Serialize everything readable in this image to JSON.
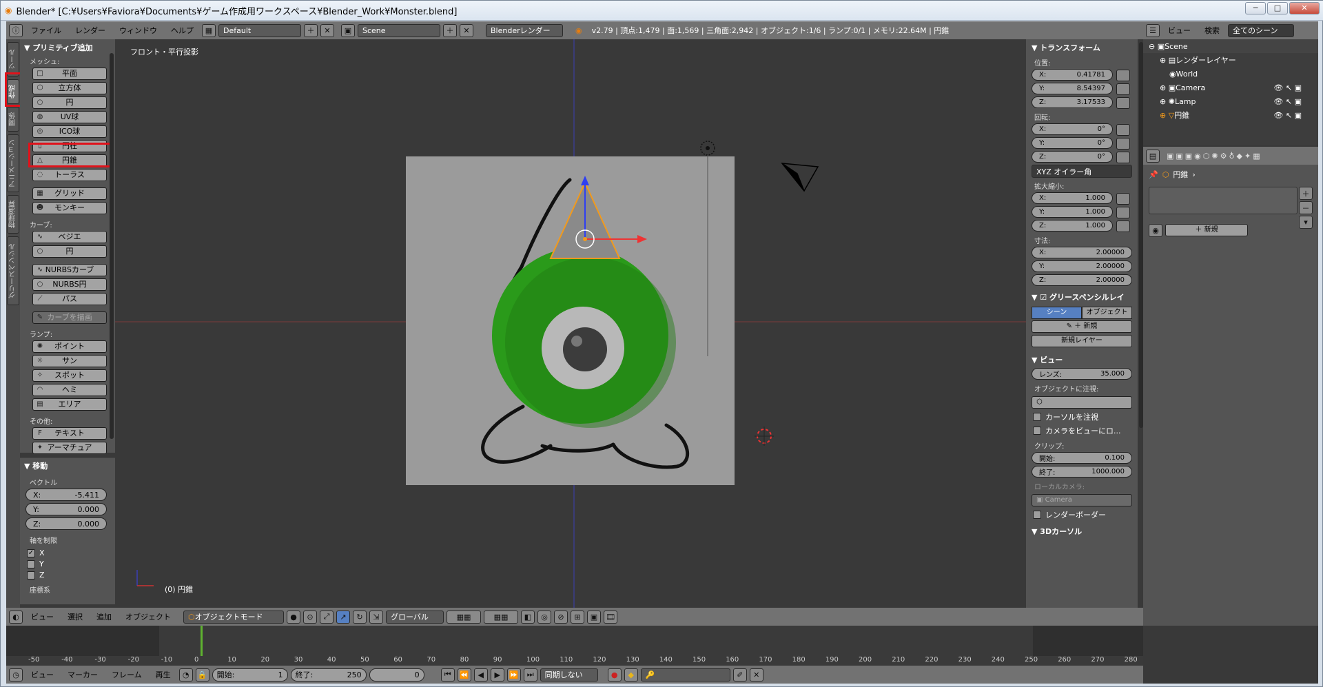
{
  "window": {
    "title": "Blender* [C:¥Users¥Faviora¥Documents¥ゲーム作成用ワークスペース¥Blender_Work¥Monster.blend]"
  },
  "info_header": {
    "menus": [
      "ファイル",
      "レンダー",
      "ウィンドウ",
      "ヘルプ"
    ],
    "layout": "Default",
    "scene": "Scene",
    "engine": "Blenderレンダー",
    "stats": "v2.79 | 頂点:1,479 | 面:1,569 | 三角面:2,942 | オブジェクト:1/6 | ランプ:0/1 | メモリ:22.64M | 円錐"
  },
  "tabs": [
    "ツール",
    "作成",
    "関係",
    "アニメーション",
    "物理演算",
    "グリースペンシル"
  ],
  "shelf": {
    "panel_title": "プリミティブ追加",
    "mesh_label": "メッシュ:",
    "mesh": [
      "平面",
      "立方体",
      "円",
      "UV球",
      "ICO球",
      "円柱",
      "円錐",
      "トーラス"
    ],
    "mesh2": [
      "グリッド",
      "モンキー"
    ],
    "curve_label": "カーブ:",
    "curve": [
      "ベジエ",
      "円"
    ],
    "nurbs": [
      "NURBSカーブ",
      "NURBS円",
      "パス"
    ],
    "draw_curve": "カーブを描画",
    "lamp_label": "ランプ:",
    "lamp": [
      "ポイント",
      "サン",
      "スポット",
      "ヘミ",
      "エリア"
    ],
    "other_label": "その他:",
    "other": [
      "テキスト",
      "アーマチュア"
    ]
  },
  "redo": {
    "title": "移動",
    "vector_label": "ベクトル",
    "x": "X:",
    "xv": "-5.411",
    "y": "Y:",
    "yv": "0.000",
    "z": "Z:",
    "zv": "0.000",
    "constraint_label": "軸を制限",
    "cx": "X",
    "cy": "Y",
    "cz": "Z",
    "coord": "座標系"
  },
  "viewport": {
    "view_label": "フロント・平行投影",
    "object_label": "(0) 円錐"
  },
  "npanel": {
    "transform": "トランスフォーム",
    "location": "位置:",
    "lx": "0.41781",
    "ly": "8.54397",
    "lz": "3.17533",
    "rotation": "回転:",
    "rx": "0°",
    "ry": "0°",
    "rz": "0°",
    "rotmode": "XYZ オイラー角",
    "scale": "拡大縮小:",
    "sx": "1.000",
    "sy": "1.000",
    "sz": "1.000",
    "dims": "寸法:",
    "dx": "2.00000",
    "dy": "2.00000",
    "dz": "2.00000",
    "gp": "グリースペンシルレイ",
    "scene_btn": "シーン",
    "object_btn": "オブジェクト",
    "new": "新規",
    "new_layer": "新規レイヤー",
    "view": "ビュー",
    "lens": "レンズ:",
    "lensv": "35.000",
    "lock_obj": "オブジェクトに注視:",
    "lock_cursor": "カーソルを注視",
    "cam_lock": "カメラをビューにロ...",
    "clip": "クリップ:",
    "clip_start": "開始:",
    "clip_start_v": "0.100",
    "clip_end": "終了:",
    "clip_end_v": "1000.000",
    "local_cam": "ローカルカメラ:",
    "camera": "Camera",
    "render_border": "レンダーボーダー",
    "cursor3d": "3Dカーソル"
  },
  "outliner": {
    "view": "ビュー",
    "search": "検索",
    "filter": "全てのシーン",
    "items": [
      "Scene",
      "レンダーレイヤー",
      "World",
      "Camera",
      "Lamp",
      "円錐"
    ]
  },
  "props": {
    "path": "円錐",
    "new": "新規"
  },
  "view3d_header": {
    "menus": [
      "ビュー",
      "選択",
      "追加",
      "オブジェクト"
    ],
    "mode": "オブジェクトモード",
    "orientation": "グローバル"
  },
  "timeline": {
    "ticks": [
      "-50",
      "-40",
      "-30",
      "-20",
      "-10",
      "0",
      "10",
      "20",
      "30",
      "40",
      "50",
      "60",
      "70",
      "80",
      "90",
      "100",
      "110",
      "120",
      "130",
      "140",
      "150",
      "160",
      "170",
      "180",
      "190",
      "200",
      "210",
      "220",
      "230",
      "240",
      "250",
      "260",
      "270",
      "280"
    ],
    "menus": [
      "ビュー",
      "マーカー",
      "フレーム",
      "再生"
    ],
    "start": "開始:",
    "start_v": "1",
    "end": "終了:",
    "end_v": "250",
    "current": "0",
    "sync": "同期しない"
  },
  "colors": {
    "accent": "#5680c2",
    "highlight": "#e0121b",
    "sphere": "#2a9a1a"
  }
}
